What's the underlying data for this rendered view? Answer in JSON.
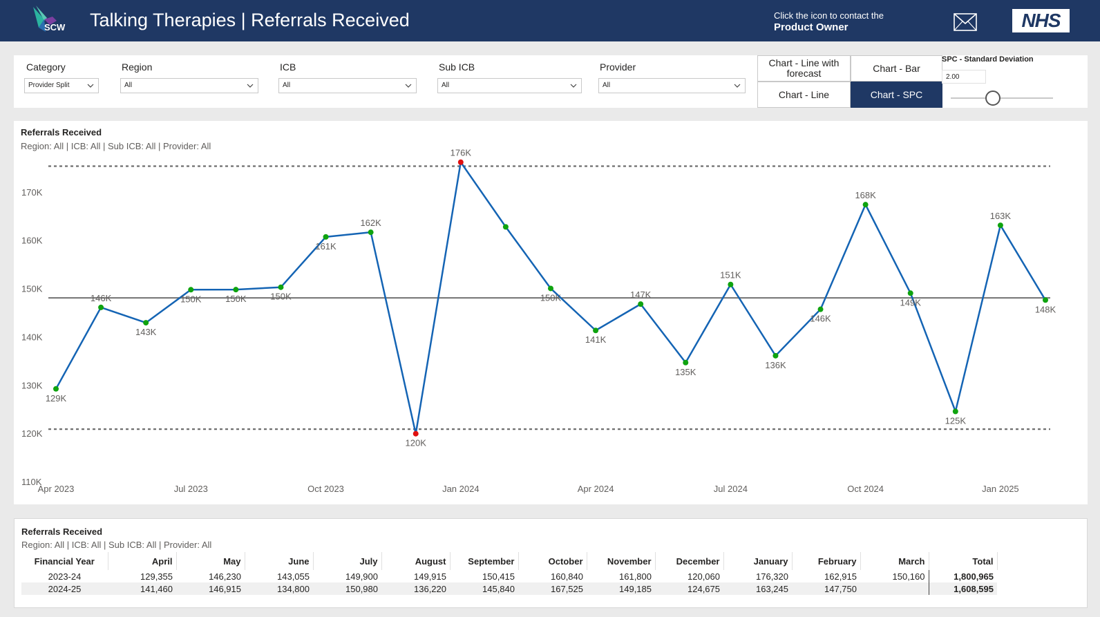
{
  "header": {
    "logo_text": "SCW",
    "title": "Talking Therapies | Referrals Received",
    "contact_line1": "Click the icon to contact the",
    "contact_line2": "Product Owner",
    "nhs_logo": "NHS"
  },
  "filters": {
    "category": {
      "label": "Category",
      "value": "Provider Split"
    },
    "region": {
      "label": "Region",
      "value": "All"
    },
    "icb": {
      "label": "ICB",
      "value": "All"
    },
    "sub_icb": {
      "label": "Sub ICB",
      "value": "All"
    },
    "provider": {
      "label": "Provider",
      "value": "All"
    }
  },
  "chart_buttons": {
    "line_forecast": "Chart - Line with forecast",
    "bar": "Chart - Bar",
    "line": "Chart - Line",
    "spc": "Chart - SPC",
    "active": "spc"
  },
  "spc_control": {
    "label": "SPC - Standard Deviation",
    "value": "2.00",
    "slider_fraction": 0.4
  },
  "chart_panel": {
    "title": "Referrals Received",
    "subtitle": "Region: All | ICB: All | Sub ICB: All | Provider: All"
  },
  "chart_data": {
    "type": "line",
    "x": [
      "2023-04",
      "2023-05",
      "2023-06",
      "2023-07",
      "2023-08",
      "2023-09",
      "2023-10",
      "2023-11",
      "2023-12",
      "2024-01",
      "2024-02",
      "2024-03",
      "2024-04",
      "2024-05",
      "2024-06",
      "2024-07",
      "2024-08",
      "2024-09",
      "2024-10",
      "2024-11",
      "2024-12",
      "2025-01",
      "2025-02"
    ],
    "values": [
      129355,
      146230,
      143055,
      149900,
      149915,
      150415,
      160840,
      161800,
      120060,
      176320,
      162915,
      150160,
      141460,
      146915,
      134800,
      150980,
      136220,
      145840,
      167525,
      149185,
      124675,
      163245,
      147750
    ],
    "point_labels": [
      "129K",
      "146K",
      "143K",
      "150K",
      "150K",
      "150K",
      "161K",
      "162K",
      "120K",
      "176K",
      "",
      "150K",
      "141K",
      "147K",
      "135K",
      "151K",
      "136K",
      "146K",
      "168K",
      "149K",
      "125K",
      "163K",
      "148K"
    ],
    "point_status": [
      "normal",
      "normal",
      "normal",
      "normal",
      "normal",
      "normal",
      "normal",
      "normal",
      "special",
      "special",
      "normal",
      "normal",
      "normal",
      "normal",
      "normal",
      "normal",
      "normal",
      "normal",
      "normal",
      "normal",
      "normal",
      "normal",
      "normal"
    ],
    "mean": 148200,
    "upper_limit": 175500,
    "lower_limit": 121000,
    "ylim": [
      110000,
      178000
    ],
    "y_ticks": [
      110000,
      120000,
      130000,
      140000,
      150000,
      160000,
      170000
    ],
    "y_tick_labels": [
      "110K",
      "120K",
      "130K",
      "140K",
      "150K",
      "160K",
      "170K"
    ],
    "x_tick_labels": [
      {
        "index": 0,
        "label": "Apr 2023"
      },
      {
        "index": 3,
        "label": "Jul 2023"
      },
      {
        "index": 6,
        "label": "Oct 2023"
      },
      {
        "index": 9,
        "label": "Jan 2024"
      },
      {
        "index": 12,
        "label": "Apr 2024"
      },
      {
        "index": 15,
        "label": "Jul 2024"
      },
      {
        "index": 18,
        "label": "Oct 2024"
      },
      {
        "index": 21,
        "label": "Jan 2025"
      }
    ],
    "colors": {
      "line": "#1464b4",
      "normal_point": "#0fa30f",
      "special_point": "#e01010",
      "limits": "#6e6e6e",
      "mean": "#7f7f7f"
    },
    "grid": false
  },
  "table_panel": {
    "title": "Referrals Received",
    "subtitle": "Region: All | ICB: All | Sub ICB: All | Provider: All",
    "headers": [
      "Financial Year",
      "April",
      "May",
      "June",
      "July",
      "August",
      "September",
      "October",
      "November",
      "December",
      "January",
      "February",
      "March",
      "Total"
    ],
    "rows": [
      [
        "2023-24",
        "129,355",
        "146,230",
        "143,055",
        "149,900",
        "149,915",
        "150,415",
        "160,840",
        "161,800",
        "120,060",
        "176,320",
        "162,915",
        "150,160",
        "1,800,965"
      ],
      [
        "2024-25",
        "141,460",
        "146,915",
        "134,800",
        "150,980",
        "136,220",
        "145,840",
        "167,525",
        "149,185",
        "124,675",
        "163,245",
        "147,750",
        "",
        "1,608,595"
      ]
    ]
  }
}
